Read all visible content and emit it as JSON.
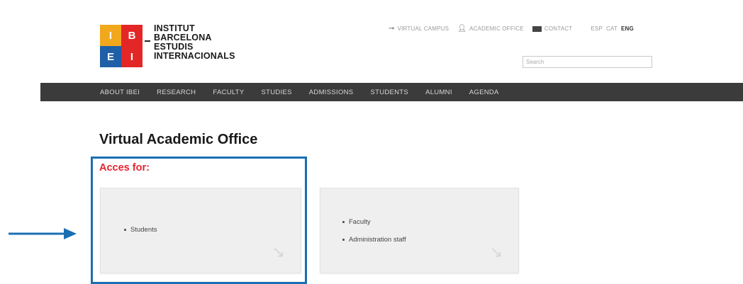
{
  "logo": {
    "grid": [
      "I",
      "B",
      "E",
      "I"
    ],
    "lines": [
      "INSTITUT",
      "BARCELONA",
      "ESTUDIS",
      "INTERNACIONALS"
    ]
  },
  "utility": {
    "virtual_campus": "VIRTUAL CAMPUS",
    "academic_office": "ACADEMIC OFFICE",
    "contact": "CONTACT",
    "languages": [
      "ESP",
      "CAT",
      "ENG"
    ],
    "active_language": "ENG"
  },
  "search": {
    "placeholder": "Search"
  },
  "nav": {
    "items": [
      "ABOUT IBEI",
      "RESEARCH",
      "FACULTY",
      "STUDIES",
      "ADMISSIONS",
      "STUDENTS",
      "ALUMNI",
      "AGENDA"
    ]
  },
  "main": {
    "title": "Virtual Academic Office",
    "access_label": "Acces for:",
    "cards": [
      {
        "items": [
          "Students"
        ]
      },
      {
        "items": [
          "Faculty",
          "Administration staff"
        ]
      }
    ]
  },
  "colors": {
    "highlight": "#1a6fb4",
    "access_label": "#e4232d",
    "nav_bg": "#3b3b3b",
    "logo_orange": "#f2a81c",
    "logo_red": "#e32626",
    "logo_blue": "#1f5fa8"
  },
  "icons": {
    "virtual_campus": "key-icon",
    "academic_office": "person-icon",
    "contact": "envelope-icon",
    "card_arrow": "arrow-icon",
    "pointer": "arrow-right-icon"
  }
}
